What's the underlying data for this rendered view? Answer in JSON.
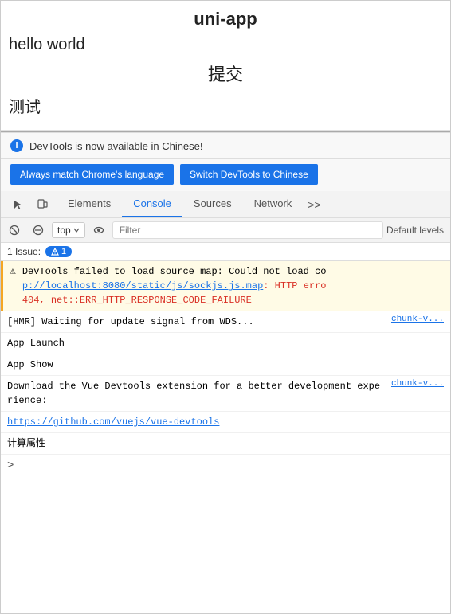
{
  "app": {
    "title": "uni-app",
    "hello": "hello world",
    "submit": "提交",
    "test": "测试"
  },
  "banner": {
    "text": "DevTools is now available in Chinese!",
    "info_icon": "i"
  },
  "buttons": {
    "always_match": "Always match Chrome's language",
    "switch_devtools": "Switch DevTools to Chinese"
  },
  "tabs": {
    "items": [
      "Elements",
      "Console",
      "Sources",
      "Network"
    ],
    "active": "Console",
    "more": ">>"
  },
  "console_toolbar": {
    "top_label": "top",
    "filter_placeholder": "Filter",
    "default_levels": "Default levels"
  },
  "issue_bar": {
    "label": "1 Issue:",
    "count": "1"
  },
  "console_entries": [
    {
      "type": "warning",
      "icon": "⚠",
      "text_parts": [
        {
          "text": "DevTools failed to load source map: Could not load co",
          "class": ""
        },
        {
          "text": "p://localhost:8080/static/js/sockjs.js.map",
          "class": "link"
        },
        {
          "text": ": HTTP erro",
          "class": ""
        },
        {
          "text": "404, net::ERR_HTTP_RESPONSE_CODE_FAILURE",
          "class": "error-text"
        }
      ],
      "right": ""
    },
    {
      "type": "normal",
      "icon": "",
      "text_parts": [
        {
          "text": "[HMR] Waiting for update signal from WDS...",
          "class": ""
        }
      ],
      "right": "chunk-v..."
    },
    {
      "type": "normal",
      "icon": "",
      "text_parts": [
        {
          "text": "App Launch",
          "class": ""
        }
      ],
      "right": ""
    },
    {
      "type": "normal",
      "icon": "",
      "text_parts": [
        {
          "text": "App Show",
          "class": ""
        }
      ],
      "right": ""
    },
    {
      "type": "normal",
      "icon": "",
      "text_parts": [
        {
          "text": "Download the Vue Devtools extension for a better development experience:",
          "class": ""
        }
      ],
      "right": "chunk-v..."
    },
    {
      "type": "link_entry",
      "icon": "",
      "link": "https://github.com/vuejs/vue-devtools",
      "right": ""
    },
    {
      "type": "normal",
      "icon": "",
      "text_parts": [
        {
          "text": "计算属性",
          "class": ""
        }
      ],
      "right": ""
    }
  ],
  "prompt": {
    "arrow": ">"
  }
}
